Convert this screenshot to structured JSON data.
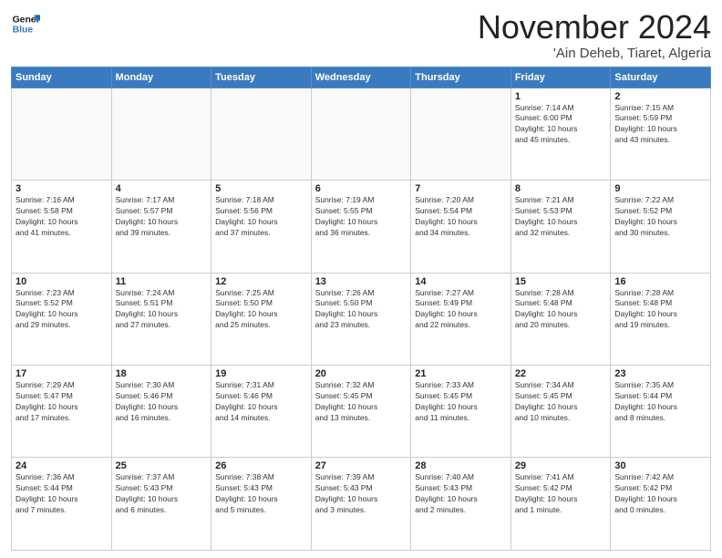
{
  "logo": {
    "line1": "General",
    "line2": "Blue"
  },
  "title": "November 2024",
  "location": "'Ain Deheb, Tiaret, Algeria",
  "weekdays": [
    "Sunday",
    "Monday",
    "Tuesday",
    "Wednesday",
    "Thursday",
    "Friday",
    "Saturday"
  ],
  "weeks": [
    [
      {
        "day": "",
        "info": ""
      },
      {
        "day": "",
        "info": ""
      },
      {
        "day": "",
        "info": ""
      },
      {
        "day": "",
        "info": ""
      },
      {
        "day": "",
        "info": ""
      },
      {
        "day": "1",
        "info": "Sunrise: 7:14 AM\nSunset: 6:00 PM\nDaylight: 10 hours\nand 45 minutes."
      },
      {
        "day": "2",
        "info": "Sunrise: 7:15 AM\nSunset: 5:59 PM\nDaylight: 10 hours\nand 43 minutes."
      }
    ],
    [
      {
        "day": "3",
        "info": "Sunrise: 7:16 AM\nSunset: 5:58 PM\nDaylight: 10 hours\nand 41 minutes."
      },
      {
        "day": "4",
        "info": "Sunrise: 7:17 AM\nSunset: 5:57 PM\nDaylight: 10 hours\nand 39 minutes."
      },
      {
        "day": "5",
        "info": "Sunrise: 7:18 AM\nSunset: 5:56 PM\nDaylight: 10 hours\nand 37 minutes."
      },
      {
        "day": "6",
        "info": "Sunrise: 7:19 AM\nSunset: 5:55 PM\nDaylight: 10 hours\nand 36 minutes."
      },
      {
        "day": "7",
        "info": "Sunrise: 7:20 AM\nSunset: 5:54 PM\nDaylight: 10 hours\nand 34 minutes."
      },
      {
        "day": "8",
        "info": "Sunrise: 7:21 AM\nSunset: 5:53 PM\nDaylight: 10 hours\nand 32 minutes."
      },
      {
        "day": "9",
        "info": "Sunrise: 7:22 AM\nSunset: 5:52 PM\nDaylight: 10 hours\nand 30 minutes."
      }
    ],
    [
      {
        "day": "10",
        "info": "Sunrise: 7:23 AM\nSunset: 5:52 PM\nDaylight: 10 hours\nand 29 minutes."
      },
      {
        "day": "11",
        "info": "Sunrise: 7:24 AM\nSunset: 5:51 PM\nDaylight: 10 hours\nand 27 minutes."
      },
      {
        "day": "12",
        "info": "Sunrise: 7:25 AM\nSunset: 5:50 PM\nDaylight: 10 hours\nand 25 minutes."
      },
      {
        "day": "13",
        "info": "Sunrise: 7:26 AM\nSunset: 5:50 PM\nDaylight: 10 hours\nand 23 minutes."
      },
      {
        "day": "14",
        "info": "Sunrise: 7:27 AM\nSunset: 5:49 PM\nDaylight: 10 hours\nand 22 minutes."
      },
      {
        "day": "15",
        "info": "Sunrise: 7:28 AM\nSunset: 5:48 PM\nDaylight: 10 hours\nand 20 minutes."
      },
      {
        "day": "16",
        "info": "Sunrise: 7:28 AM\nSunset: 5:48 PM\nDaylight: 10 hours\nand 19 minutes."
      }
    ],
    [
      {
        "day": "17",
        "info": "Sunrise: 7:29 AM\nSunset: 5:47 PM\nDaylight: 10 hours\nand 17 minutes."
      },
      {
        "day": "18",
        "info": "Sunrise: 7:30 AM\nSunset: 5:46 PM\nDaylight: 10 hours\nand 16 minutes."
      },
      {
        "day": "19",
        "info": "Sunrise: 7:31 AM\nSunset: 5:46 PM\nDaylight: 10 hours\nand 14 minutes."
      },
      {
        "day": "20",
        "info": "Sunrise: 7:32 AM\nSunset: 5:45 PM\nDaylight: 10 hours\nand 13 minutes."
      },
      {
        "day": "21",
        "info": "Sunrise: 7:33 AM\nSunset: 5:45 PM\nDaylight: 10 hours\nand 11 minutes."
      },
      {
        "day": "22",
        "info": "Sunrise: 7:34 AM\nSunset: 5:45 PM\nDaylight: 10 hours\nand 10 minutes."
      },
      {
        "day": "23",
        "info": "Sunrise: 7:35 AM\nSunset: 5:44 PM\nDaylight: 10 hours\nand 8 minutes."
      }
    ],
    [
      {
        "day": "24",
        "info": "Sunrise: 7:36 AM\nSunset: 5:44 PM\nDaylight: 10 hours\nand 7 minutes."
      },
      {
        "day": "25",
        "info": "Sunrise: 7:37 AM\nSunset: 5:43 PM\nDaylight: 10 hours\nand 6 minutes."
      },
      {
        "day": "26",
        "info": "Sunrise: 7:38 AM\nSunset: 5:43 PM\nDaylight: 10 hours\nand 5 minutes."
      },
      {
        "day": "27",
        "info": "Sunrise: 7:39 AM\nSunset: 5:43 PM\nDaylight: 10 hours\nand 3 minutes."
      },
      {
        "day": "28",
        "info": "Sunrise: 7:40 AM\nSunset: 5:43 PM\nDaylight: 10 hours\nand 2 minutes."
      },
      {
        "day": "29",
        "info": "Sunrise: 7:41 AM\nSunset: 5:42 PM\nDaylight: 10 hours\nand 1 minute."
      },
      {
        "day": "30",
        "info": "Sunrise: 7:42 AM\nSunset: 5:42 PM\nDaylight: 10 hours\nand 0 minutes."
      }
    ]
  ]
}
